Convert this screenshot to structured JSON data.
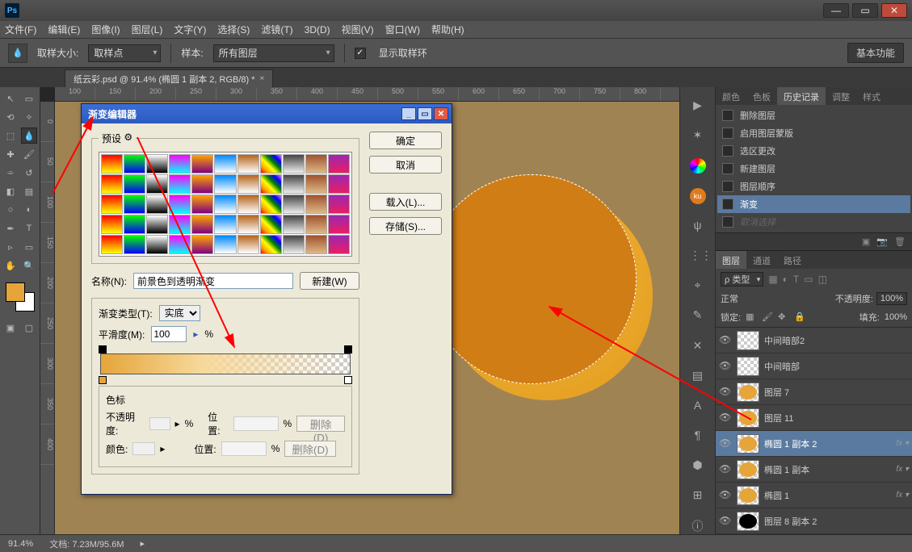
{
  "app": {
    "logo": "Ps"
  },
  "window": {
    "min": "—",
    "max": "▭",
    "close": "✕"
  },
  "menubar": [
    "文件(F)",
    "编辑(E)",
    "图像(I)",
    "图层(L)",
    "文字(Y)",
    "选择(S)",
    "滤镜(T)",
    "3D(D)",
    "视图(V)",
    "窗口(W)",
    "帮助(H)"
  ],
  "optbar": {
    "sample_size_label": "取样大小:",
    "sample_size_value": "取样点",
    "sample_label": "样本:",
    "sample_value": "所有图层",
    "show_ring": "显示取样环",
    "essentials": "基本功能"
  },
  "doctab": {
    "title": "纸云彩.psd @ 91.4% (椭圆 1 副本 2, RGB/8) *"
  },
  "ruler_h": [
    "100",
    "150",
    "200",
    "250",
    "300",
    "350",
    "400",
    "450",
    "500",
    "550",
    "600",
    "650",
    "700",
    "750",
    "800"
  ],
  "ruler_v": [
    "0",
    "50",
    "100",
    "150",
    "200",
    "250",
    "300",
    "350",
    "400"
  ],
  "statusbar": {
    "zoom": "91.4%",
    "doc": "文档: 7.23M/95.6M"
  },
  "panel_tabs_top": {
    "color": "颜色",
    "swatches": "色板",
    "history": "历史记录",
    "adjust": "调整",
    "styles": "样式"
  },
  "history": [
    {
      "label": "删除图层"
    },
    {
      "label": "启用图层蒙版"
    },
    {
      "label": "选区更改"
    },
    {
      "label": "新建图层"
    },
    {
      "label": "图层顺序"
    },
    {
      "label": "渐变",
      "selected": true
    },
    {
      "label": "取消选择",
      "dim": true
    }
  ],
  "panel_tabs_layers": {
    "layers": "图层",
    "channels": "通道",
    "paths": "路径"
  },
  "layers_head": {
    "kind": "ρ 类型",
    "blend": "正常",
    "opacity_label": "不透明度:",
    "opacity": "100%",
    "lock": "锁定:",
    "fill_label": "填充:",
    "fill": "100%"
  },
  "layers": [
    {
      "name": "中间暗部2",
      "fill": ""
    },
    {
      "name": "中间暗部",
      "fill": ""
    },
    {
      "name": "图层 7",
      "fill": "#e5a53a"
    },
    {
      "name": "图层 11",
      "fill": "#e5a53a"
    },
    {
      "name": "椭圆 1 副本 2",
      "fill": "#e5a53a",
      "selected": true,
      "fx": "fx"
    },
    {
      "name": "椭圆 1 副本",
      "fill": "#e5a53a",
      "fx": "fx"
    },
    {
      "name": "椭圆 1",
      "fill": "#e5a53a",
      "fx": "fx"
    },
    {
      "name": "图层 8 副本 2",
      "fill": "#000"
    }
  ],
  "dialog": {
    "title": "渐变编辑器",
    "presets_label": "预设",
    "ok": "确定",
    "cancel": "取消",
    "load": "载入(L)...",
    "save": "存储(S)...",
    "new": "新建(W)",
    "name_label": "名称(N):",
    "name_value": "前景色到透明渐变",
    "gtype_label": "渐变类型(T):",
    "gtype_value": "实底",
    "smooth_label": "平滑度(M):",
    "smooth_value": "100",
    "stops_label": "色标",
    "opacity_label": "不透明度:",
    "pos_label": "位置:",
    "color_label": "颜色:",
    "delete": "删除(D)",
    "pct": "%",
    "gear": "⚙"
  }
}
